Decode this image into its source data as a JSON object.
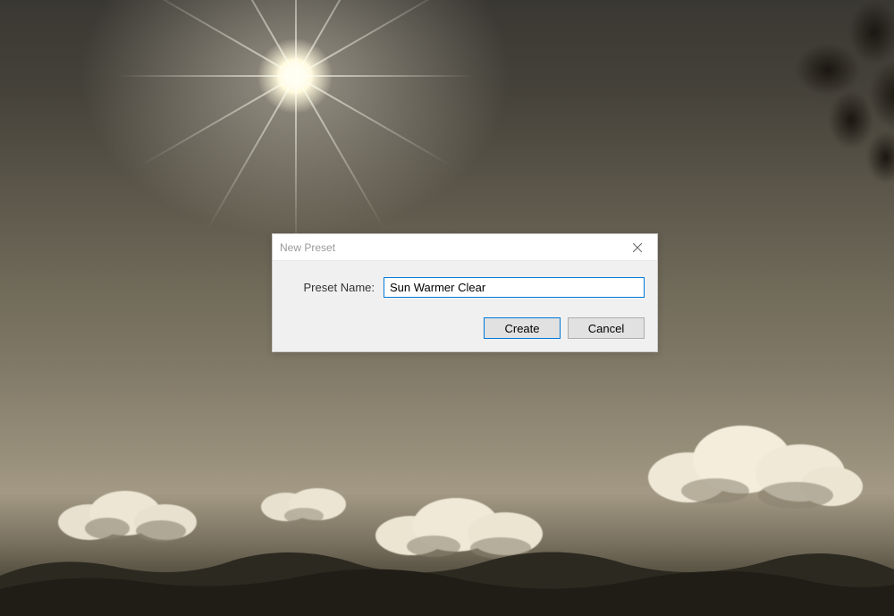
{
  "dialog": {
    "title": "New Preset",
    "label": "Preset Name:",
    "input_value": "Sun Warmer Clear",
    "create_label": "Create",
    "cancel_label": "Cancel"
  }
}
